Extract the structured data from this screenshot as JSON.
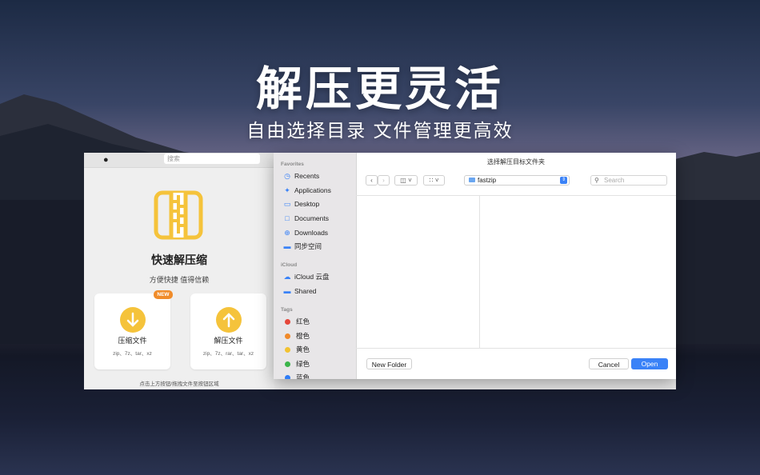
{
  "hero": {
    "title": "解压更灵活",
    "subtitle": "自由选择目录 文件管理更高效"
  },
  "app": {
    "search_placeholder": "搜索",
    "name": "快速解压缩",
    "tagline": "方便快捷 值得信赖",
    "badge": "NEW",
    "compress_card": {
      "label": "压缩文件",
      "formats": "zip、7z、tar、xz"
    },
    "extract_card": {
      "label": "解压文件",
      "formats": "zip、7z、rar、tar、xz"
    },
    "footer_hint": "点击上方按钮/拖拽文件至按钮区域"
  },
  "dialog": {
    "title": "选择解压目标文件夹",
    "path": "fastzip",
    "search_placeholder": "Search",
    "sidebar": {
      "favorites_header": "Favorites",
      "favorites": [
        {
          "label": "Recents",
          "icon": "clock-icon"
        },
        {
          "label": "Applications",
          "icon": "applications-icon"
        },
        {
          "label": "Desktop",
          "icon": "desktop-icon"
        },
        {
          "label": "Documents",
          "icon": "document-icon"
        },
        {
          "label": "Downloads",
          "icon": "download-icon"
        },
        {
          "label": "同步空间",
          "icon": "folder-icon"
        }
      ],
      "icloud_header": "iCloud",
      "icloud": [
        {
          "label": "iCloud 云盘",
          "icon": "cloud-icon"
        },
        {
          "label": "Shared",
          "icon": "shared-folder-icon"
        }
      ],
      "tags_header": "Tags",
      "tags": [
        {
          "label": "红色",
          "color": "#e5463a"
        },
        {
          "label": "橙色",
          "color": "#f0892a"
        },
        {
          "label": "黄色",
          "color": "#f2c231"
        },
        {
          "label": "绿色",
          "color": "#3bb54a"
        },
        {
          "label": "蓝色",
          "color": "#2f7cf6"
        }
      ]
    },
    "new_folder_label": "New Folder",
    "cancel_label": "Cancel",
    "open_label": "Open",
    "accent_color": "#3a82f7"
  }
}
